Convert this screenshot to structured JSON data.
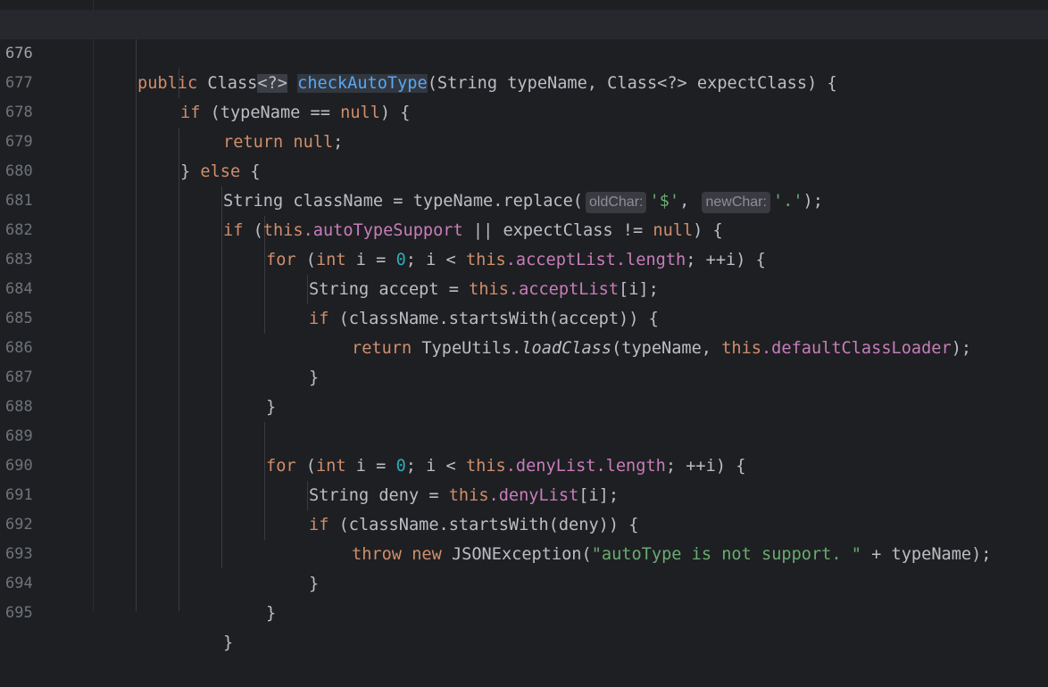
{
  "editor": {
    "lines": [
      {
        "num": "676",
        "current": true
      },
      {
        "num": "677"
      },
      {
        "num": "678"
      },
      {
        "num": "679"
      },
      {
        "num": "680"
      },
      {
        "num": "681"
      },
      {
        "num": "682"
      },
      {
        "num": "683"
      },
      {
        "num": "684"
      },
      {
        "num": "685"
      },
      {
        "num": "686"
      },
      {
        "num": "687"
      },
      {
        "num": "688"
      },
      {
        "num": "689"
      },
      {
        "num": "690"
      },
      {
        "num": "691"
      },
      {
        "num": "692"
      },
      {
        "num": "693"
      },
      {
        "num": "694"
      },
      {
        "num": "695"
      }
    ],
    "hints": {
      "oldChar": "oldChar:",
      "newChar": "newChar:"
    },
    "tokens": {
      "public": "public",
      "class_generic": "Class",
      "generic_open": "<?>",
      "method": "checkAutoType",
      "params": "(String typeName, Class<?> expectClass) {",
      "if": "if",
      "typeName_null": " (typeName == ",
      "null": "null",
      ") {": ") {",
      "return": "return",
      "null_semi": ";",
      "close_else": "} ",
      "else": "else",
      " {": " {",
      "string_decl": "String className = typeName.replace(",
      "dollar": "'$'",
      "comma": ", ",
      "dot_str": "'.'",
      "close_paren": ");",
      "paren_open": " (",
      "this": "this",
      "autoTypeSupport": ".autoTypeSupport",
      "or_expect": " || expectClass != ",
      "close_brace_paren": ") {",
      "for": "for",
      "int": "int",
      "i_eq": " i = ",
      "zero": "0",
      "semi_i_lt": "; i < ",
      "acceptList": ".acceptList",
      "length": ".length",
      "inc": "; ++i) {",
      "string_accept": "String accept = ",
      "idx": "[i];",
      "startsWith_accept": " (className.startsWith(accept)) {",
      "typeutils": " TypeUtils.",
      "loadClass": "loadClass",
      "typeName_comma": "(typeName, ",
      "defaultClassLoader": ".defaultClassLoader",
      "close": "}",
      "denyList": ".denyList",
      "string_deny": "String deny = ",
      "startsWith_deny": " (className.startsWith(deny)) {",
      "throw": "throw",
      "new": "new",
      "jsonex": " JSONException(",
      "msg": "\"autoType is not support. \"",
      "plus_tn": " + typeName);"
    }
  },
  "colors": {
    "background": "#1e1f22",
    "keyword": "#cf8e6d",
    "string": "#6aab73",
    "number": "#2aacb8",
    "field": "#c77dbb",
    "function": "#56a8f5",
    "text": "#bcbec4"
  }
}
